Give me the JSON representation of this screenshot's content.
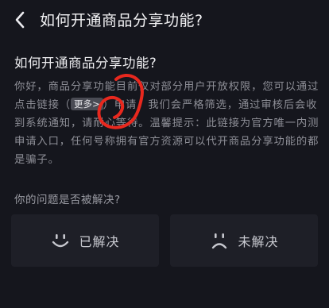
{
  "header": {
    "back_icon": "chevron-left-icon",
    "title": "如何开通商品分享功能?"
  },
  "question": {
    "title": "如何开通商品分享功能?"
  },
  "answer": {
    "text_before": "你好，商品分享功能目前仅对部分用户开放权限，您可以通过点击链接（",
    "link_label": "更多>",
    "text_after": "）申请，我们会严格筛选，通过审核后会收到系统通知，请耐心等待。温馨提示：此链接为官方唯一内测申请入口，任何号称拥有官方资源可以代开商品分享功能的都是骗子。"
  },
  "feedback": {
    "question": "你的问题是否被解决?",
    "resolved_label": "已解决",
    "resolved_icon": "smile-icon",
    "unresolved_label": "未解决",
    "unresolved_icon": "frown-icon"
  },
  "colors": {
    "background": "#15161d",
    "annotation_red": "#e8281e",
    "button_bg": "#1e1f27"
  }
}
